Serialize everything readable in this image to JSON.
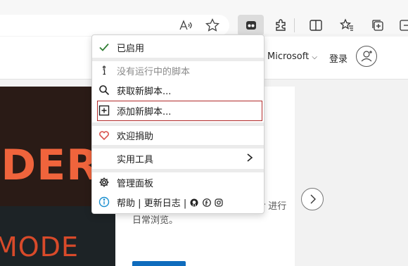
{
  "browser": {
    "toolbar_icons": [
      "read-aloud-icon",
      "favorite-star-icon",
      "extension-icon",
      "puzzle-extensions-icon",
      "split-screen-icon",
      "favorites-icon",
      "collections-icon",
      "profile-icon"
    ]
  },
  "site": {
    "microsoft_label": "Microsoft",
    "microsoft_chevron": "⌵",
    "login_label": "登录",
    "hero_word": "ADER",
    "hero_mode": "MODE",
    "card_text": "关爱眼睛，就使用 Dark Reader 进行日常浏览。"
  },
  "menu": {
    "enabled_label": "已启用",
    "no_scripts_label": "没有运行中的脚本",
    "get_scripts_label": "获取新脚本...",
    "add_script_label": "添加新脚本...",
    "donate_label": "欢迎捐助",
    "utilities_label": "实用工具",
    "dashboard_label": "管理面板",
    "help_label": "帮助",
    "changelog_label": "更新日志",
    "separator": "|",
    "colors": {
      "check": "#2e7d32",
      "heart": "#d9534f",
      "info": "#1b8fcf",
      "focus": "#b12a2a"
    }
  }
}
